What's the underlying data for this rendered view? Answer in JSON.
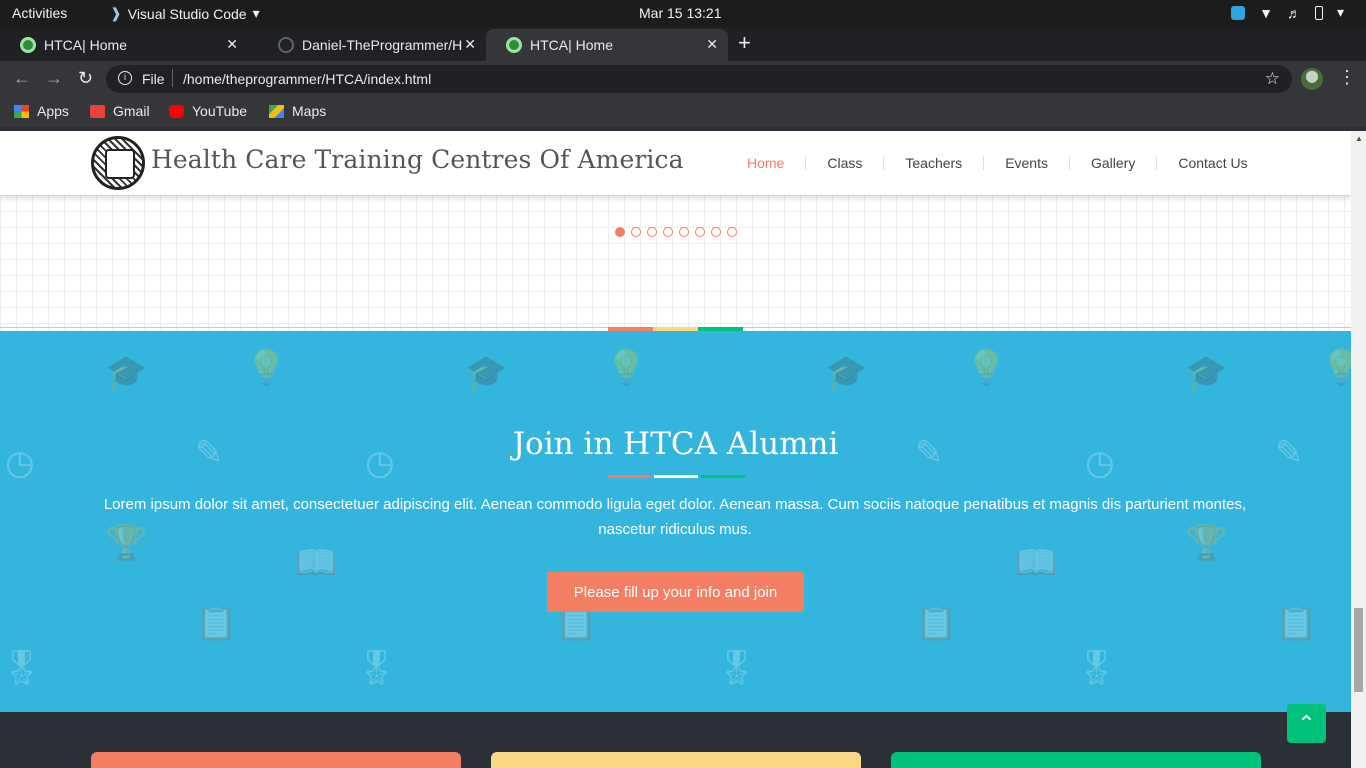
{
  "system_bar": {
    "activities": "Activities",
    "app_name": "Visual Studio Code",
    "clock": "Mar 15  13:21"
  },
  "browser": {
    "tabs": [
      {
        "label": "HTCA| Home",
        "active": false
      },
      {
        "label": "Daniel-TheProgrammer/H",
        "active": false
      },
      {
        "label": "HTCA| Home",
        "active": true
      }
    ],
    "new_tab": "+",
    "address": {
      "scheme": "File",
      "url": "/home/theprogrammer/HTCA/index.html"
    },
    "bookmarks": [
      {
        "label": "Apps",
        "icon": "apps-icon"
      },
      {
        "label": "Gmail",
        "icon": "gmail-icon"
      },
      {
        "label": "YouTube",
        "icon": "youtube-icon"
      },
      {
        "label": "Maps",
        "icon": "maps-icon"
      }
    ]
  },
  "site": {
    "brand": "Health Care Training Centres Of America",
    "nav": [
      "Home",
      "Class",
      "Teachers",
      "Events",
      "Gallery",
      "Contact Us"
    ],
    "active_nav": "Home",
    "slider": {
      "dot_count": 8,
      "active_index": 0
    },
    "alumni": {
      "title": "Join in HTCA Alumni",
      "text": "Lorem ipsum dolor sit amet, consectetuer adipiscing elit. Aenean commodo ligula eget dolor. Aenean massa. Cum sociis natoque penatibus et magnis dis parturient montes, nascetur ridiculus mus.",
      "button": "Please fill up your info and join"
    },
    "colors": {
      "accent": "#f47e64",
      "yellow": "#fcd885",
      "green": "#00c27a",
      "alumni_bg": "#34b5dd",
      "dark_bg": "#2b2f36"
    }
  }
}
